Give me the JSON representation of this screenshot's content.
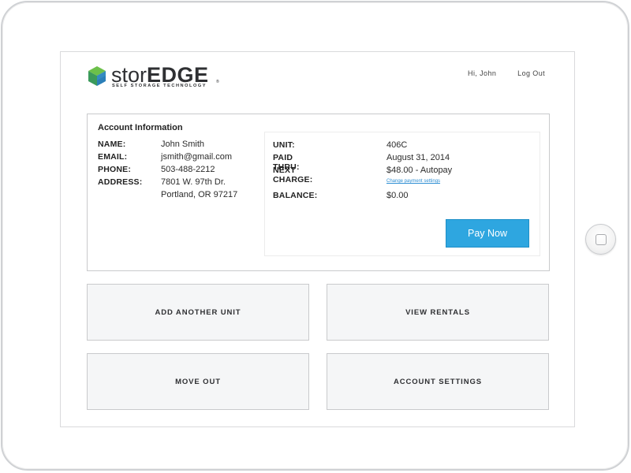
{
  "brand": {
    "name_light": "stor",
    "name_bold": "EDGE",
    "registered": "®",
    "tagline": "SELF STORAGE TECHNOLOGY",
    "colors": {
      "cube_left": "#3b9a5b",
      "cube_right": "#2b7fb8",
      "cube_top": "#6cc04a"
    }
  },
  "header": {
    "greeting": "Hi, John",
    "logout_label": "Log Out"
  },
  "account": {
    "title": "Account Information",
    "left_rows": [
      {
        "label": "NAME:",
        "value": "John Smith"
      },
      {
        "label": "EMAIL:",
        "value": "jsmith@gmail.com"
      },
      {
        "label": "PHONE:",
        "value": "503-488-2212"
      },
      {
        "label": "ADDRESS:",
        "value": "7801 W. 97th Dr."
      },
      {
        "label": "",
        "value": "Portland, OR 97217"
      }
    ],
    "right_rows": [
      {
        "label": "UNIT:",
        "value": "406C"
      },
      {
        "label": "PAID THRU:",
        "value": "August 31, 2014"
      },
      {
        "label": "NEXT CHARGE:",
        "value": "$48.00 - Autopay"
      },
      {
        "label": "",
        "value": ""
      },
      {
        "label": "BALANCE:",
        "value": "$0.00"
      }
    ],
    "payment_settings_link": "Change payment settings",
    "pay_now_label": "Pay Now",
    "accent_color": "#2ea6e0"
  },
  "tiles": [
    {
      "label": "ADD ANOTHER UNIT"
    },
    {
      "label": "VIEW RENTALS"
    },
    {
      "label": "MOVE OUT"
    },
    {
      "label": "ACCOUNT SETTINGS"
    }
  ],
  "device": {
    "home_button_icon": "home-button-icon"
  }
}
